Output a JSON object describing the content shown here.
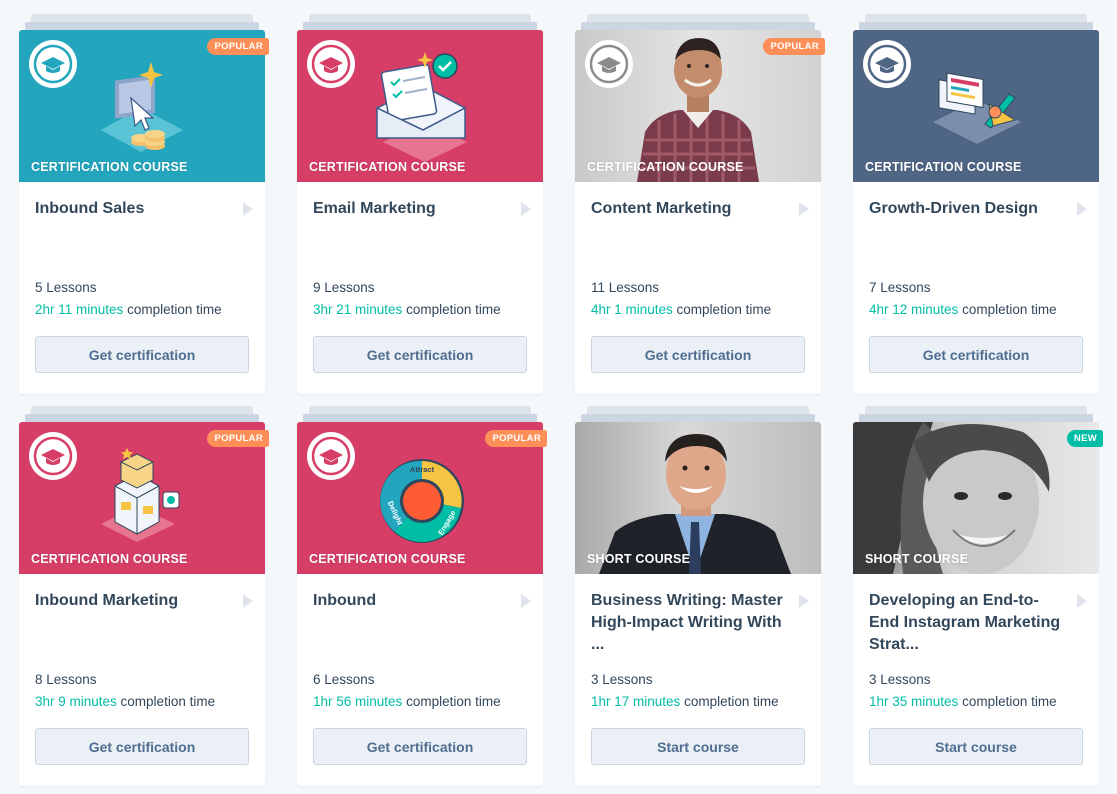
{
  "colors": {
    "teal": "#23a5bd",
    "magenta": "#d63e68",
    "slate": "#4f6584",
    "popular_badge": "#ff8f59",
    "new_badge": "#00bda5",
    "duration": "#00bda5"
  },
  "cards": [
    {
      "badge": "POPULAR",
      "type": "CERTIFICATION COURSE",
      "title": "Inbound Sales",
      "lessons": "5 Lessons",
      "duration": "2hr 11 minutes",
      "suffix": " completion time",
      "button": "Get certification",
      "hero": "teal",
      "icon": "computer-cursor-coins-icon"
    },
    {
      "badge": "",
      "type": "CERTIFICATION COURSE",
      "title": "Email Marketing",
      "lessons": "9 Lessons",
      "duration": "3hr 21 minutes",
      "suffix": " completion time",
      "button": "Get certification",
      "hero": "magenta",
      "icon": "envelope-checklist-icon"
    },
    {
      "badge": "POPULAR",
      "type": "CERTIFICATION COURSE",
      "title": "Content Marketing",
      "lessons": "11 Lessons",
      "duration": "4hr 1 minutes",
      "suffix": " completion time",
      "button": "Get certification",
      "hero": "photo",
      "icon": "instructor-photo"
    },
    {
      "badge": "",
      "type": "CERTIFICATION COURSE",
      "title": "Growth-Driven Design",
      "lessons": "7 Lessons",
      "duration": "4hr 12 minutes",
      "suffix": " completion time",
      "button": "Get certification",
      "hero": "slate",
      "icon": "design-tools-icon"
    },
    {
      "badge": "POPULAR",
      "type": "CERTIFICATION COURSE",
      "title": "Inbound Marketing",
      "lessons": "8 Lessons",
      "duration": "3hr 9 minutes",
      "suffix": " completion time",
      "button": "Get certification",
      "hero": "magenta",
      "icon": "building-blocks-icon"
    },
    {
      "badge": "POPULAR",
      "type": "CERTIFICATION COURSE",
      "title": "Inbound",
      "lessons": "6 Lessons",
      "duration": "1hr 56 minutes",
      "suffix": " completion time",
      "button": "Get certification",
      "hero": "magenta",
      "icon": "flywheel-icon",
      "flywheel": [
        "Attract",
        "Engage",
        "Delight"
      ]
    },
    {
      "badge": "",
      "type": "SHORT COURSE",
      "title": "Business Writing: Master High-Impact Writing With ...",
      "lessons": "3 Lessons",
      "duration": "1hr 17 minutes",
      "suffix": " completion time",
      "button": "Start course",
      "hero": "photo",
      "icon": "instructor-photo"
    },
    {
      "badge": "NEW",
      "type": "SHORT COURSE",
      "title": "Developing an End-to-End Instagram Marketing Strat...",
      "lessons": "3 Lessons",
      "duration": "1hr 35 minutes",
      "suffix": " completion time",
      "button": "Start course",
      "hero": "photo",
      "icon": "instructor-photo"
    }
  ]
}
